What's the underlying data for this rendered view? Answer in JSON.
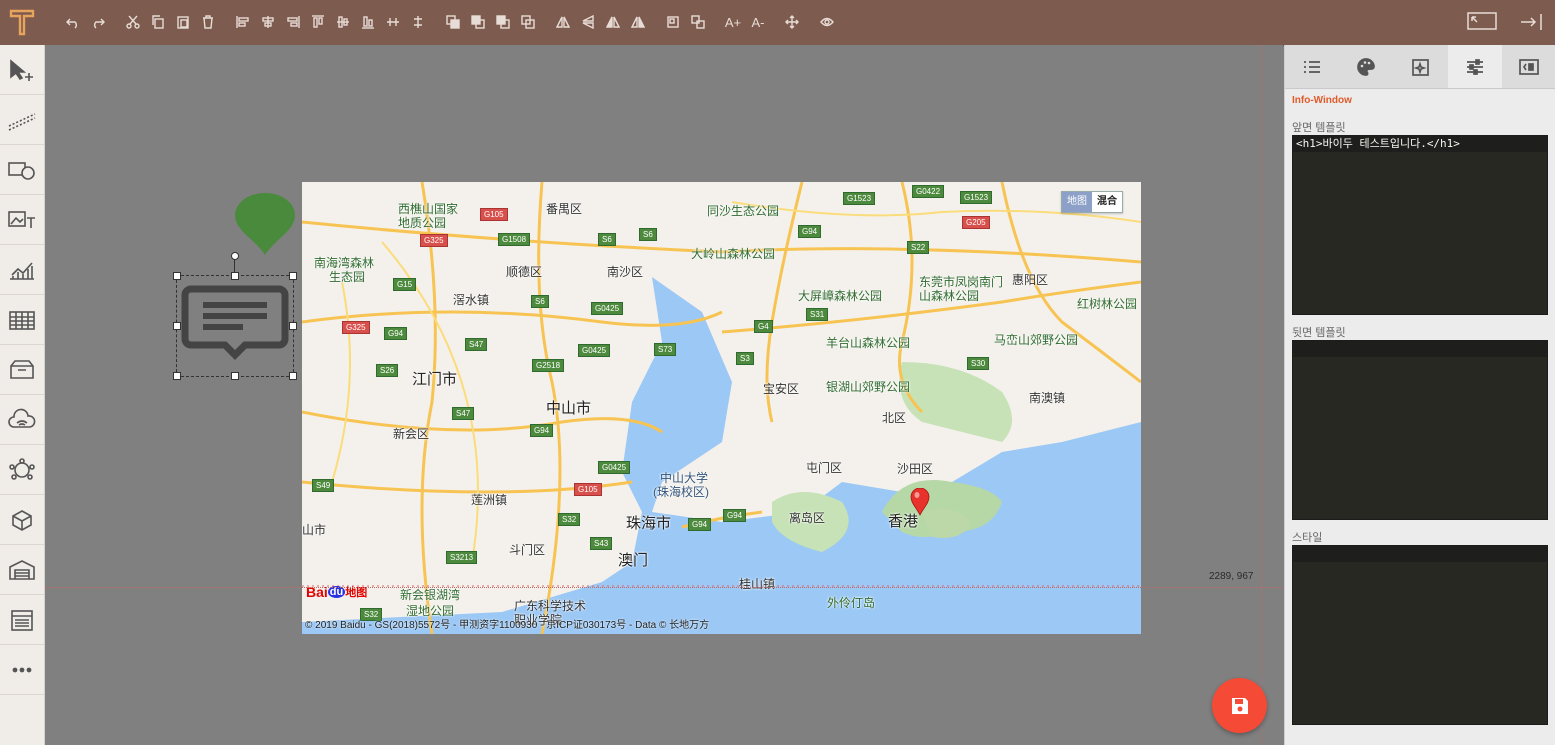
{
  "toolbar": {
    "logo": "T",
    "groups": [
      "undo",
      "redo",
      "cut",
      "copy",
      "paste",
      "delete",
      "align-left",
      "align-center",
      "align-right",
      "align-top",
      "align-middle",
      "align-bottom",
      "distribute-h",
      "distribute-v",
      "bring-front",
      "send-back",
      "bring-forward",
      "send-backward",
      "flip-h",
      "flip-v",
      "flip-h2",
      "flip-v2",
      "group",
      "ungroup",
      "font-up",
      "font-down",
      "move",
      "preview"
    ],
    "font_up_label": "A+",
    "font_down_label": "A-",
    "right": [
      "fullscreen-icon",
      "exit-icon"
    ]
  },
  "left_tools": [
    "pointer-add",
    "line",
    "rect-circle",
    "image-text",
    "chart",
    "table",
    "box",
    "cloud",
    "network",
    "cube",
    "warehouse",
    "panel",
    "more"
  ],
  "canvas": {
    "coords": "2289, 967"
  },
  "map": {
    "type_buttons": {
      "map": "地图",
      "mixed": "混合"
    },
    "copyright": "© 2019 Baidu - GS(2018)5572号 - 甲测资字1100930 - 京ICP证030173号 - Data © 长地万方",
    "logo": {
      "bai": "Bai",
      "du": "du",
      "ditu": "地图"
    },
    "labels": [
      {
        "t": "西樵山国家",
        "c": "green"
      },
      {
        "t": "地质公园",
        "c": "green"
      },
      {
        "t": "番禺区",
        "c": ""
      },
      {
        "t": "同沙生态公园",
        "c": "green"
      },
      {
        "t": "大岭山森林公园",
        "c": "green"
      },
      {
        "t": "南海湾森林",
        "c": "green"
      },
      {
        "t": "生态园",
        "c": "green"
      },
      {
        "t": "顺德区",
        "c": ""
      },
      {
        "t": "南沙区",
        "c": ""
      },
      {
        "t": "大屏嶂森林公园",
        "c": "green"
      },
      {
        "t": "东莞市凤岗南门",
        "c": "green"
      },
      {
        "t": "山森林公园",
        "c": "green"
      },
      {
        "t": "惠阳区",
        "c": ""
      },
      {
        "t": "红树林公园",
        "c": "green"
      },
      {
        "t": "滘水镇",
        "c": ""
      },
      {
        "t": "羊台山森林公园",
        "c": "green"
      },
      {
        "t": "马峦山郊野公园",
        "c": "green"
      },
      {
        "t": "江门市",
        "c": "big"
      },
      {
        "t": "中山市",
        "c": "big"
      },
      {
        "t": "宝安区",
        "c": ""
      },
      {
        "t": "银湖山郊野公园",
        "c": "green"
      },
      {
        "t": "南澳镇",
        "c": ""
      },
      {
        "t": "新会区",
        "c": ""
      },
      {
        "t": "北区",
        "c": ""
      },
      {
        "t": "屯门区",
        "c": ""
      },
      {
        "t": "沙田区",
        "c": ""
      },
      {
        "t": "中山大学",
        "c": "blue"
      },
      {
        "t": "(珠海校区)",
        "c": "blue"
      },
      {
        "t": "莲洲镇",
        "c": ""
      },
      {
        "t": "香港",
        "c": "big"
      },
      {
        "t": "珠海市",
        "c": "big"
      },
      {
        "t": "离岛区",
        "c": ""
      },
      {
        "t": "山市",
        "c": ""
      },
      {
        "t": "斗门区",
        "c": ""
      },
      {
        "t": "澳门",
        "c": "big"
      },
      {
        "t": "桂山镇",
        "c": ""
      },
      {
        "t": "新会银湖湾",
        "c": "green"
      },
      {
        "t": "湿地公园",
        "c": "green"
      },
      {
        "t": "广东科学技术",
        "c": ""
      },
      {
        "t": "职业学院",
        "c": ""
      },
      {
        "t": "外伶仃岛",
        "c": "green"
      }
    ],
    "highways": [
      {
        "t": "G105",
        "r": true
      },
      {
        "t": "G325",
        "r": true
      },
      {
        "t": "G1508",
        "r": false
      },
      {
        "t": "S6",
        "r": false
      },
      {
        "t": "S6",
        "r": false
      },
      {
        "t": "G1523",
        "r": false
      },
      {
        "t": "G0422",
        "r": false
      },
      {
        "t": "G1523",
        "r": false
      },
      {
        "t": "G205",
        "r": true
      },
      {
        "t": "G94",
        "r": false
      },
      {
        "t": "S22",
        "r": false
      },
      {
        "t": "G15",
        "r": false
      },
      {
        "t": "S6",
        "r": false
      },
      {
        "t": "G0425",
        "r": false
      },
      {
        "t": "S31",
        "r": false
      },
      {
        "t": "G4",
        "r": false
      },
      {
        "t": "G325",
        "r": true
      },
      {
        "t": "G94",
        "r": false
      },
      {
        "t": "S47",
        "r": false
      },
      {
        "t": "G0425",
        "r": false
      },
      {
        "t": "S73",
        "r": false
      },
      {
        "t": "S3",
        "r": false
      },
      {
        "t": "S26",
        "r": false
      },
      {
        "t": "G2518",
        "r": false
      },
      {
        "t": "S30",
        "r": false
      },
      {
        "t": "S47",
        "r": false
      },
      {
        "t": "G94",
        "r": false
      },
      {
        "t": "G0425",
        "r": false
      },
      {
        "t": "S49",
        "r": false
      },
      {
        "t": "G105",
        "r": true
      },
      {
        "t": "G94",
        "r": false
      },
      {
        "t": "G94",
        "r": false
      },
      {
        "t": "S32",
        "r": false
      },
      {
        "t": "S43",
        "r": false
      },
      {
        "t": "S3213",
        "r": false
      },
      {
        "t": "S32",
        "r": false
      }
    ]
  },
  "panel": {
    "tabs": [
      "list-icon",
      "palette-icon",
      "magic-icon",
      "sliders-icon",
      "code-icon"
    ],
    "active_tab": 3,
    "title": "Info-Window",
    "front_label": "앞면 템플릿",
    "front_code": "<h1>바이두 테스트입니다.</h1>",
    "back_label": "뒷면 템플릿",
    "back_code": "",
    "style_label": "스타일",
    "style_code": ""
  },
  "colors": {
    "toolbar": "#7d5b4e",
    "accent": "#e05a2a",
    "save": "#f44a36",
    "pin_green": "#4a8a3c",
    "editor_bg": "#272822"
  }
}
